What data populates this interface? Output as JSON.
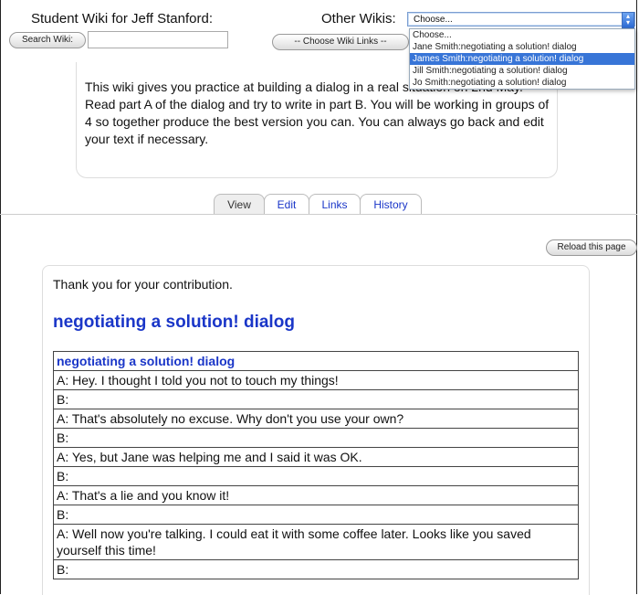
{
  "header": {
    "title": "Student Wiki for Jeff Stanford:",
    "other_wikis_label": "Other Wikis:",
    "select_value": "Choose...",
    "dropdown_options": [
      "Choose...",
      "Jane Smith:negotiating a solution! dialog",
      "James Smith:negotiating a solution! dialog",
      "Jill Smith:negotiating a solution! dialog",
      "Jo Smith:negotiating a solution! dialog"
    ],
    "selected_option_index": 2,
    "search_button": "Search Wiki:",
    "search_value": "",
    "wiki_links_button": "-- Choose Wiki Links --"
  },
  "description": "This wiki gives you practice at building a dialog in a real situation on 2nd May. Read part A of the dialog and try to write in part B. You will be working in groups of 4 so together produce the best version you can. You can always go back and edit your text if necessary.",
  "tabs": [
    {
      "label": "View"
    },
    {
      "label": "Edit"
    },
    {
      "label": "Links"
    },
    {
      "label": "History"
    }
  ],
  "reload_button": "Reload this page",
  "main": {
    "thanks": "Thank you for your contribution.",
    "page_title": "negotiating a solution! dialog",
    "table_header": "negotiating a solution! dialog",
    "rows": [
      "A: Hey. I thought I told you not to touch my things!",
      "B:",
      "A: That's absolutely no excuse. Why don't you use your own?",
      "B:",
      "A: Yes, but Jane was helping me and I said it was OK.",
      "B:",
      "A: That's a lie and you know it!",
      "B:",
      "A: Well now you're talking. I could eat it with some coffee later. Looks like you saved yourself this time!",
      "B:"
    ]
  }
}
